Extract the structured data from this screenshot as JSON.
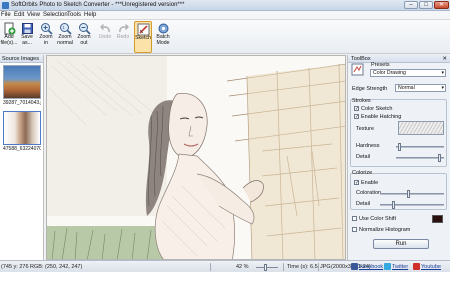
{
  "window": {
    "title": "SoftOrbits Photo to Sketch Converter - ***Unregistered version***",
    "buttons": {
      "minimize": "–",
      "maximize": "□",
      "close": "✕"
    }
  },
  "menu": [
    "File",
    "Edit",
    "View",
    "Selection",
    "Tools",
    "Help"
  ],
  "toolbar": {
    "buttons": [
      {
        "label": "Add\nfile(s)...",
        "icon": "add-file-icon",
        "state": "enabled"
      },
      {
        "label": "Save\nas...",
        "icon": "save-icon",
        "state": "enabled"
      },
      {
        "label": "Zoom\nin",
        "icon": "zoom-in-icon",
        "state": "enabled"
      },
      {
        "label": "Zoom\nnormal",
        "icon": "zoom-normal-icon",
        "state": "enabled"
      },
      {
        "label": "Zoom\nout",
        "icon": "zoom-out-icon",
        "state": "enabled"
      },
      {
        "label": "Undo",
        "icon": "undo-icon",
        "state": "disabled"
      },
      {
        "label": "Redo",
        "icon": "redo-icon",
        "state": "disabled"
      },
      {
        "label": "Sketch",
        "icon": "sketch-icon",
        "state": "pressed"
      },
      {
        "label": "Batch\nMode",
        "icon": "batch-mode-icon",
        "state": "enabled"
      }
    ]
  },
  "source_panel": {
    "title": "Source Images",
    "images": [
      {
        "filename": "39287_7014043.jpg"
      },
      {
        "filename": "47588_63224070.jpg"
      }
    ]
  },
  "toolbox": {
    "title": "ToolBox",
    "close": "✕",
    "presets_label": "Presets",
    "preset_value": "Color Drawing",
    "edge_strength_label": "Edge Strength",
    "edge_strength_value": "Normal",
    "strokes": {
      "title": "Strokes",
      "color_sketch": {
        "label": "Color Sketch",
        "checked": true
      },
      "enable_hatching": {
        "label": "Enable Hatching",
        "checked": true
      },
      "texture_label": "Texture",
      "hardness_label": "Hardness",
      "hardness_level": 0.05,
      "detail_label": "Detail",
      "detail_level": 0.95
    },
    "colorize": {
      "title": "Colorize",
      "enable": {
        "label": "Enable",
        "checked": true
      },
      "coloration_label": "Coloration",
      "coloration_level": 0.45,
      "detail_label": "Detail",
      "detail_level": 0.2
    },
    "use_color_shift": {
      "label": "Use Color Shift",
      "checked": false,
      "color": "#2a0f0f"
    },
    "normalize_histogram": {
      "label": "Normalize Histogram",
      "checked": false
    },
    "run_label": "Run"
  },
  "statusbar": {
    "coords": "(745 y: 276  RGB: (250, 242, 247)",
    "zoom": "42 %",
    "time": "Time (s): 6.5",
    "format": "JPG",
    "dimensions": "(2000x3000x24)",
    "facebook": "Facebook",
    "twitter": "Twitter",
    "youtube": "Youtube"
  }
}
